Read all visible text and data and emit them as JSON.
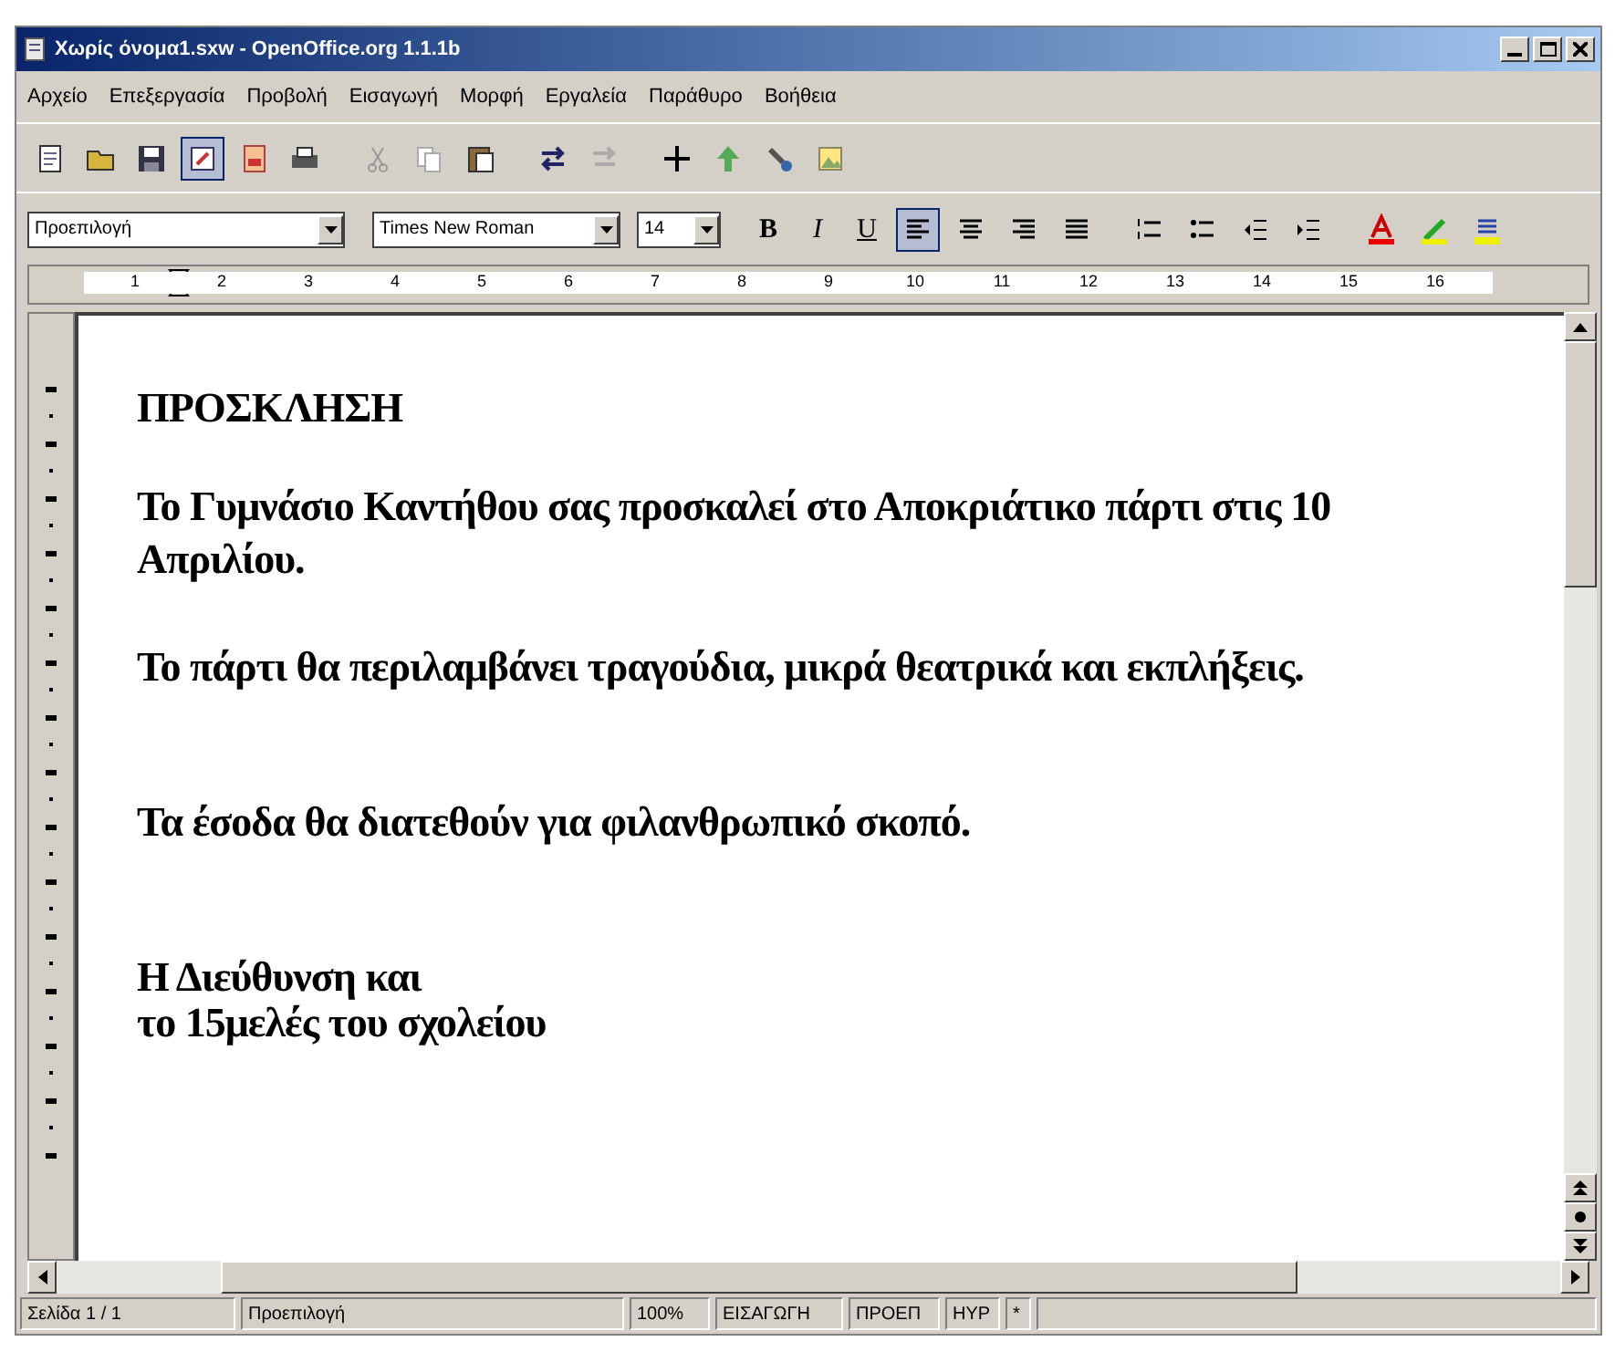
{
  "window": {
    "title": "Χωρίς όνομα1.sxw - OpenOffice.org 1.1.1b"
  },
  "menu": [
    "Αρχείο",
    "Επεξεργασία",
    "Προβολή",
    "Εισαγωγή",
    "Μορφή",
    "Εργαλεία",
    "Παράθυρο",
    "Βοήθεια"
  ],
  "toolbar": [
    {
      "kind": "new",
      "selected": false
    },
    {
      "kind": "open",
      "selected": false
    },
    {
      "kind": "save",
      "selected": false
    },
    {
      "kind": "edit",
      "selected": true
    },
    {
      "kind": "pdf",
      "selected": false
    },
    {
      "kind": "print",
      "selected": false
    },
    {
      "kind": "cut",
      "selected": false
    },
    {
      "kind": "copy",
      "selected": false
    },
    {
      "kind": "paste",
      "selected": false
    },
    {
      "kind": "swap",
      "selected": false
    },
    {
      "kind": "swap2",
      "selected": false
    },
    {
      "kind": "cross",
      "selected": false
    },
    {
      "kind": "up",
      "selected": false
    },
    {
      "kind": "brush",
      "selected": false
    },
    {
      "kind": "gallery",
      "selected": false
    }
  ],
  "format_bar": {
    "style": "Προεπιλογή",
    "font": "Times New Roman",
    "size": "14",
    "text_buttons": [
      {
        "label": "B",
        "selected": false
      },
      {
        "label": "I",
        "selected": false
      },
      {
        "label": "U",
        "selected": false
      }
    ],
    "buttons": [
      {
        "kind": "align-left",
        "selected": true
      },
      {
        "kind": "align-center",
        "selected": false
      },
      {
        "kind": "align-right",
        "selected": false
      },
      {
        "kind": "justify",
        "selected": false
      },
      {
        "kind": "numbering",
        "selected": false
      },
      {
        "kind": "bullets",
        "selected": false
      },
      {
        "kind": "outdent",
        "selected": false
      },
      {
        "kind": "indent",
        "selected": false
      },
      {
        "kind": "font-color",
        "selected": false
      },
      {
        "kind": "highlight",
        "selected": false
      },
      {
        "kind": "background",
        "selected": false
      }
    ]
  },
  "ruler": [
    "1",
    "2",
    "3",
    "4",
    "5",
    "6",
    "7",
    "8",
    "9",
    "10",
    "11",
    "12",
    "13",
    "14",
    "15",
    "16"
  ],
  "document": [
    "ΠΡΟΣΚΛΗΣΗ",
    "Το Γυμνάσιο Καντήθου σας προσκαλεί στο Αποκριάτικο πάρτι στις 10 Απριλίου.",
    "Το πάρτι θα περιλαμβάνει τραγούδια, μικρά θεατρικά και εκπλήξεις.",
    "Τα έσοδα θα διατεθούν για φιλανθρωπικό σκοπό.",
    "Η Διεύθυνση και",
    "το 15μελές του σχολείου"
  ],
  "status_bar": [
    "Σελίδα 1 / 1",
    "Προεπιλογή",
    "100%",
    "ΕΙΣΑΓΩΓΗ",
    "ΠΡΟΕΠ",
    "HYP",
    "*"
  ]
}
